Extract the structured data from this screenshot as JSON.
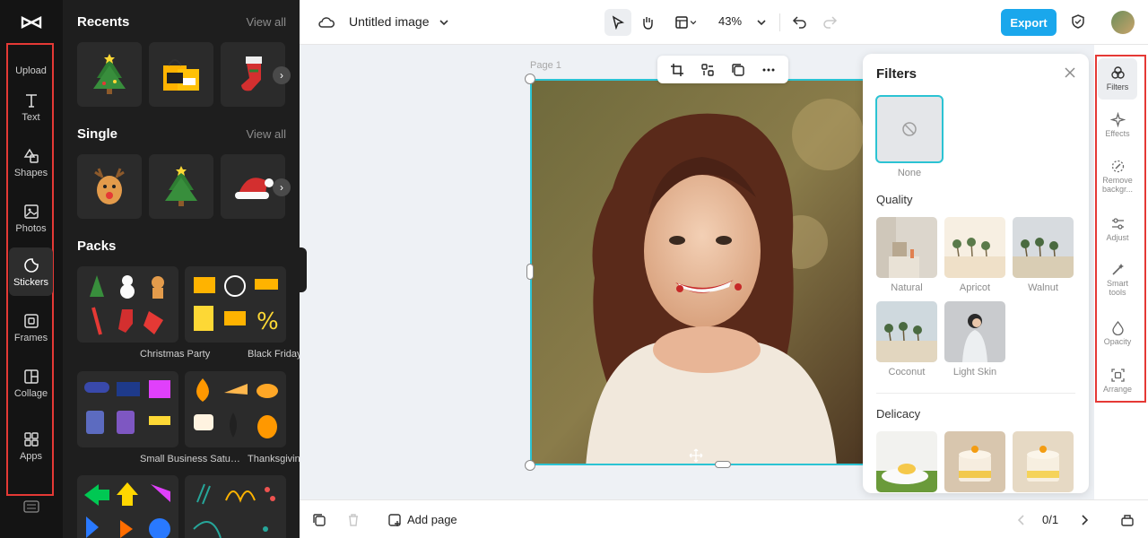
{
  "rail": {
    "items": [
      {
        "label": "Upload",
        "icon": "upload-icon"
      },
      {
        "label": "Text",
        "icon": "text-icon"
      },
      {
        "label": "Shapes",
        "icon": "shapes-icon"
      },
      {
        "label": "Photos",
        "icon": "photos-icon"
      },
      {
        "label": "Stickers",
        "icon": "stickers-icon",
        "active": true
      },
      {
        "label": "Frames",
        "icon": "frames-icon"
      },
      {
        "label": "Collage",
        "icon": "collage-icon"
      },
      {
        "label": "Apps",
        "icon": "apps-icon"
      }
    ]
  },
  "panel": {
    "recents_title": "Recents",
    "single_title": "Single",
    "packs_title": "Packs",
    "view_all": "View all",
    "packs": [
      {
        "label": "Christmas Party"
      },
      {
        "label": "Black Friday/Cyber M..."
      },
      {
        "label": "Small Business Saturd..."
      },
      {
        "label": "Thanksgiving"
      }
    ]
  },
  "topbar": {
    "doc_title": "Untitled image",
    "zoom": "43%",
    "export_label": "Export"
  },
  "canvas": {
    "page_label": "Page 1"
  },
  "filters": {
    "title": "Filters",
    "none_label": "None",
    "quality_title": "Quality",
    "delicacy_title": "Delicacy",
    "quality_items": [
      {
        "label": "Natural"
      },
      {
        "label": "Apricot"
      },
      {
        "label": "Walnut"
      },
      {
        "label": "Coconut"
      },
      {
        "label": "Light Skin"
      }
    ]
  },
  "right_rail": {
    "items": [
      {
        "label": "Filters",
        "icon": "filters-icon",
        "active": true
      },
      {
        "label": "Effects",
        "icon": "effects-icon"
      },
      {
        "label": "Remove backgr...",
        "icon": "remove-background-icon"
      },
      {
        "label": "Adjust",
        "icon": "adjust-icon"
      },
      {
        "label": "Smart tools",
        "icon": "smart-tools-icon"
      },
      {
        "label": "Opacity",
        "icon": "opacity-icon"
      },
      {
        "label": "Arrange",
        "icon": "arrange-icon"
      }
    ]
  },
  "bottombar": {
    "add_page_label": "Add page",
    "page_count": "0/1"
  },
  "colors": {
    "accent": "#1aa7ec",
    "selection": "#2bc3d3",
    "highlight_box": "#e53935"
  }
}
